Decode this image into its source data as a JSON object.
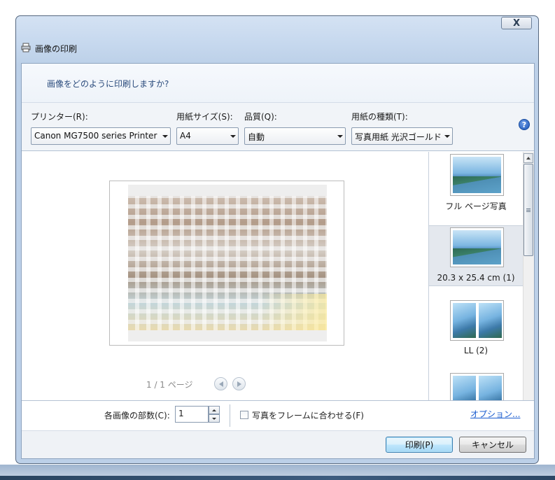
{
  "window": {
    "title": "画像の印刷",
    "close_symbol": "X"
  },
  "header": {
    "question": "画像をどのように印刷しますか?"
  },
  "options": {
    "printer_label": "プリンター(R):",
    "printer_value": "Canon MG7500 series Printer",
    "paper_size_label": "用紙サイズ(S):",
    "paper_size_value": "A4",
    "quality_label": "品質(Q):",
    "quality_value": "自動",
    "paper_type_label": "用紙の種類(T):",
    "paper_type_value": "写真用紙 光沢ゴールド",
    "help_symbol": "?"
  },
  "preview": {
    "pager_text": "1 / 1 ページ"
  },
  "layouts": [
    {
      "label": "フル ページ写真",
      "selected": false
    },
    {
      "label": "20.3 x 25.4 cm (1)",
      "selected": true
    },
    {
      "label": "LL (2)",
      "selected": false
    },
    {
      "label": "",
      "selected": false
    }
  ],
  "bottom": {
    "copies_label": "各画像の部数(C):",
    "copies_value": "1",
    "fit_label": "写真をフレームに合わせる(F)",
    "fit_checked": false,
    "options_link": "オプション..."
  },
  "buttons": {
    "print": "印刷(P)",
    "cancel": "キャンセル"
  },
  "icons": {
    "title_icon": "printer-icon",
    "help_icon": "help-icon",
    "prev_icon": "prev-page-icon",
    "next_icon": "next-page-icon"
  },
  "colors": {
    "link": "#1a5ccf",
    "question_text": "#2a4b7c",
    "selected_layout_bg": "#e4e8ee"
  }
}
